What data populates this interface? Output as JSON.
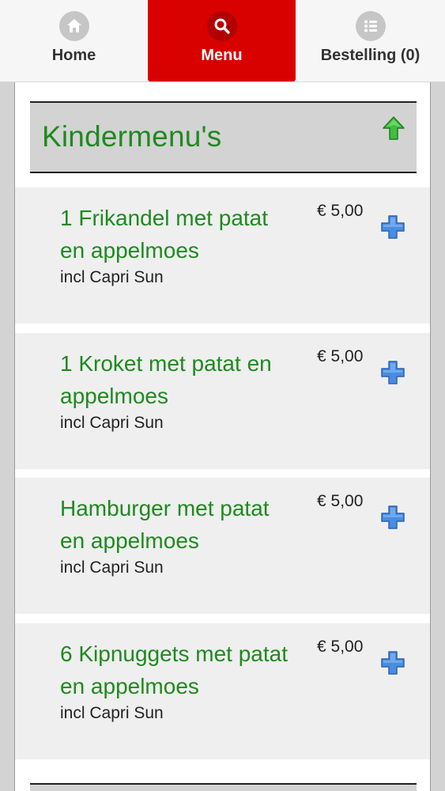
{
  "nav": {
    "tabs": [
      {
        "label": "Home",
        "icon": "home-icon",
        "active": false
      },
      {
        "label": "Menu",
        "icon": "search-icon",
        "active": true
      },
      {
        "label": "Bestelling (0)",
        "icon": "list-icon",
        "active": false
      }
    ]
  },
  "section": {
    "title": "Kindermenu's"
  },
  "items": [
    {
      "name": "1 Frikandel met patat en appelmoes",
      "description": "incl Capri Sun",
      "price": "€ 5,00"
    },
    {
      "name": "1 Kroket met patat en appelmoes",
      "description": "incl Capri Sun",
      "price": "€ 5,00"
    },
    {
      "name": "Hamburger met patat en appelmoes",
      "description": "incl Capri Sun",
      "price": "€ 5,00"
    },
    {
      "name": "6 Kipnuggets met patat en appelmoes",
      "description": "incl Capri Sun",
      "price": "€ 5,00"
    }
  ],
  "colors": {
    "accent": "#d90000",
    "title_green": "#1f8a1f",
    "add_blue": "#3b7fd6"
  }
}
